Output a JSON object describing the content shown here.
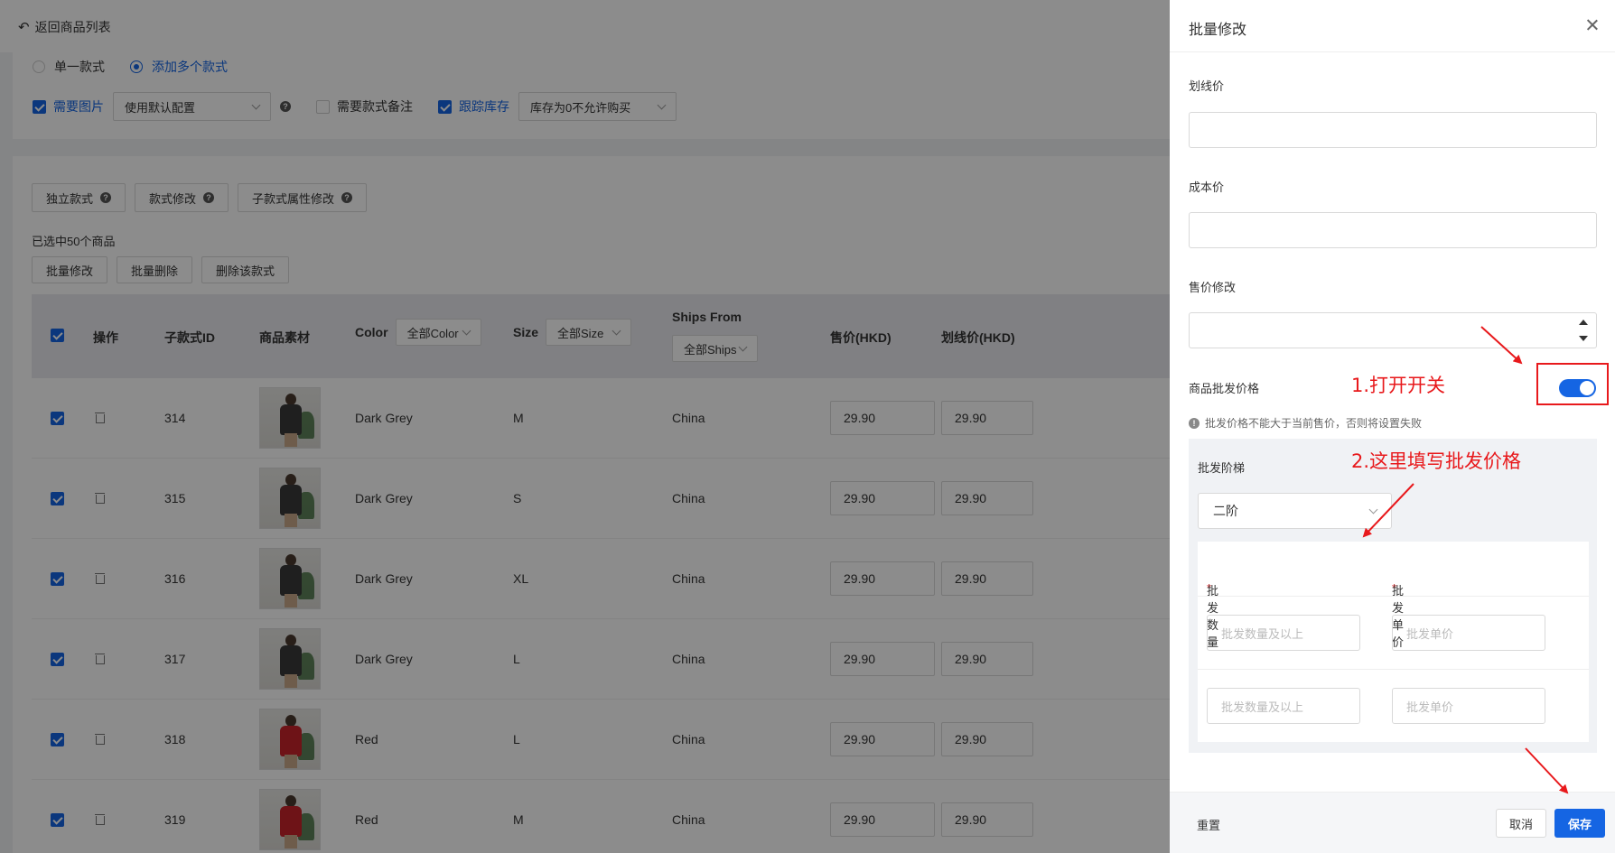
{
  "page": {
    "back_label": "返回商品列表",
    "radio_single": "单一款式",
    "radio_multi": "添加多个款式",
    "need_image": "需要图片",
    "default_config": "使用默认配置",
    "need_remark": "需要款式备注",
    "track_stock": "跟踪库存",
    "stock_policy": "库存为0不允许购买",
    "btn_independent": "独立款式",
    "btn_style_edit": "款式修改",
    "btn_sub_attr": "子款式属性修改",
    "selected_count": "已选中50个商品",
    "btn_batch_edit": "批量修改",
    "btn_batch_delete": "批量删除",
    "btn_delete_style": "删除该款式"
  },
  "table": {
    "headers": {
      "op": "操作",
      "sub_id": "子款式ID",
      "material": "商品素材",
      "color": "Color",
      "color_filter": "全部Color",
      "size": "Size",
      "size_filter": "全部Size",
      "ships_from": "Ships From",
      "ships_filter": "全部Ships",
      "price": "售价(HKD)",
      "strike_price": "划线价(HKD)"
    },
    "rows": [
      {
        "id": "314",
        "color": "Dark Grey",
        "size": "M",
        "ships": "China",
        "price": "29.90",
        "strike": "29.90"
      },
      {
        "id": "315",
        "color": "Dark Grey",
        "size": "S",
        "ships": "China",
        "price": "29.90",
        "strike": "29.90"
      },
      {
        "id": "316",
        "color": "Dark Grey",
        "size": "XL",
        "ships": "China",
        "price": "29.90",
        "strike": "29.90"
      },
      {
        "id": "317",
        "color": "Dark Grey",
        "size": "L",
        "ships": "China",
        "price": "29.90",
        "strike": "29.90"
      },
      {
        "id": "318",
        "color": "Red",
        "size": "L",
        "ships": "China",
        "price": "29.90",
        "strike": "29.90"
      },
      {
        "id": "319",
        "color": "Red",
        "size": "M",
        "ships": "China",
        "price": "29.90",
        "strike": "29.90"
      }
    ]
  },
  "drawer": {
    "title": "批量修改",
    "strike_price_label": "划线价",
    "cost_price_label": "成本价",
    "price_edit_label": "售价修改",
    "wholesale_label": "商品批发价格",
    "wholesale_note": "批发价格不能大于当前售价，否则将设置失败",
    "tier_label": "批发阶梯",
    "tier_value": "二阶",
    "qty_header": "批发数量",
    "unit_header": "批发单价",
    "qty_placeholder": "批发数量及以上",
    "unit_placeholder": "批发单价",
    "reset": "重置",
    "cancel": "取消",
    "save": "保存"
  },
  "annotations": {
    "step1": "1.打开开关",
    "step2": "2.这里填写批发价格"
  },
  "colors": {
    "accent": "#1565e3",
    "annotation": "#e8191c"
  }
}
